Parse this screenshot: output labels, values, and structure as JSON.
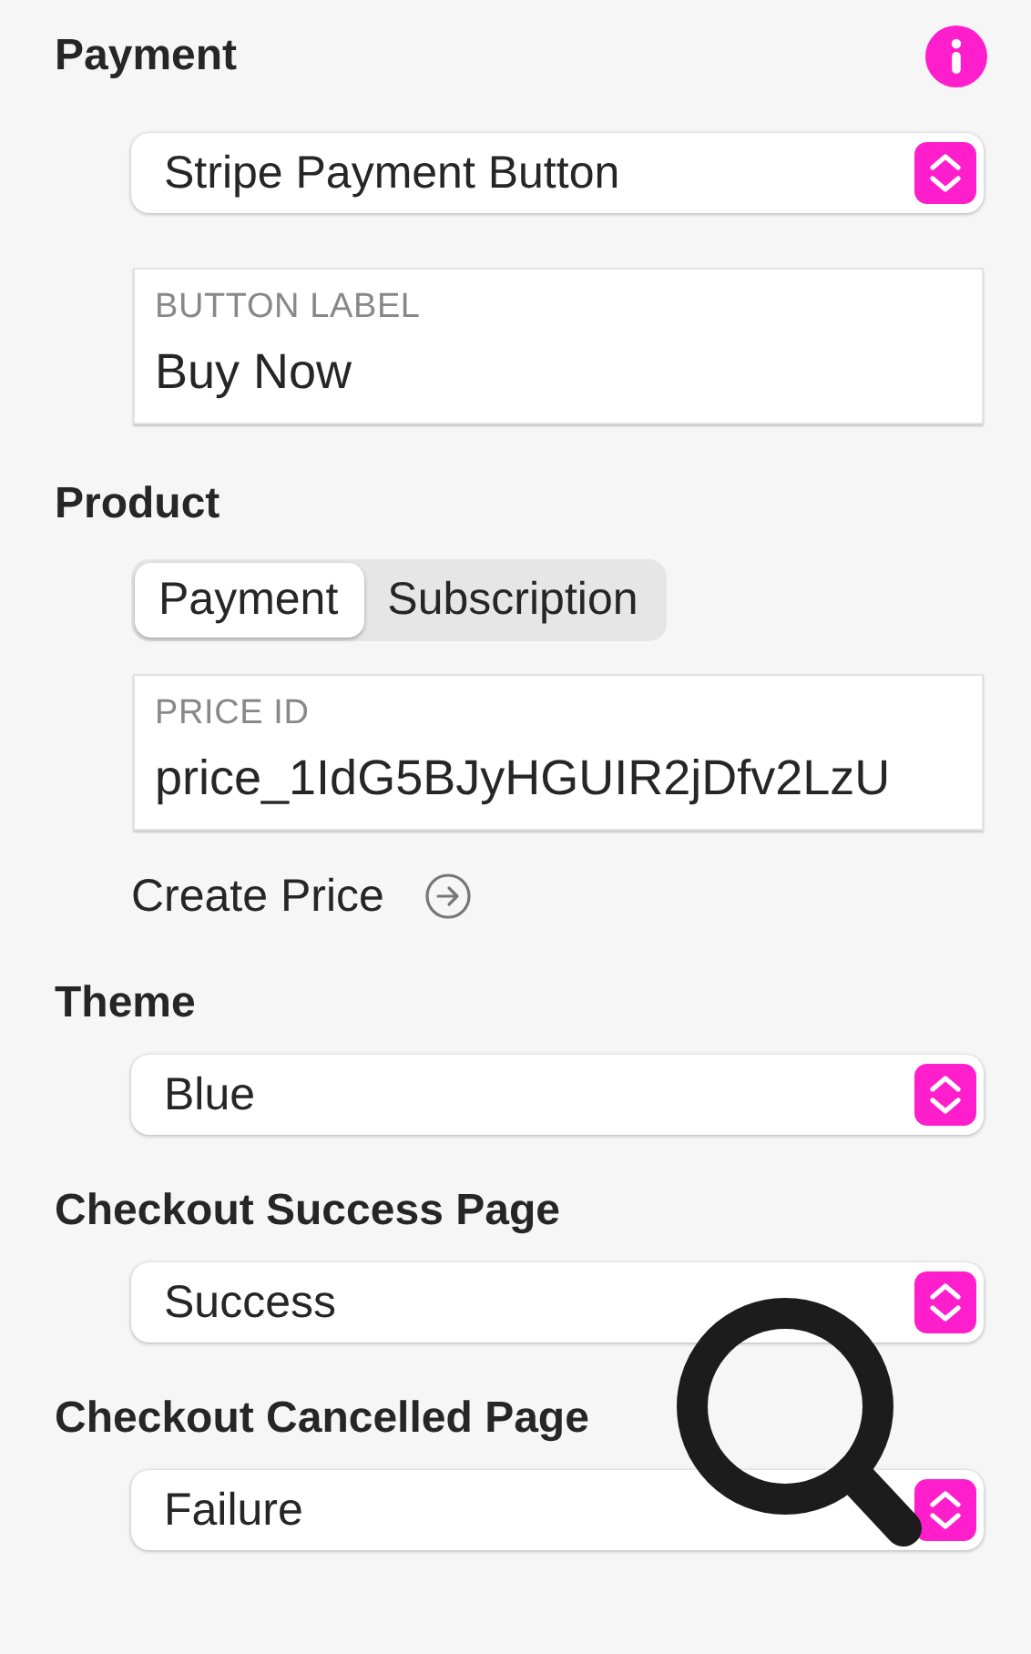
{
  "payment": {
    "heading": "Payment",
    "widget_type": "Stripe Payment Button",
    "button_label": {
      "label": "BUTTON LABEL",
      "value": "Buy Now"
    }
  },
  "product": {
    "heading": "Product",
    "modes": [
      {
        "label": "Payment",
        "selected": true
      },
      {
        "label": "Subscription",
        "selected": false
      }
    ],
    "price_id": {
      "label": "PRICE ID",
      "value": "price_1IdG5BJyHGUIR2jDfv2LzU"
    },
    "create_price_link": "Create Price"
  },
  "theme": {
    "heading": "Theme",
    "value": "Blue"
  },
  "success_page": {
    "heading": "Checkout Success Page",
    "value": "Success"
  },
  "cancelled_page": {
    "heading": "Checkout Cancelled Page",
    "value": "Failure"
  }
}
